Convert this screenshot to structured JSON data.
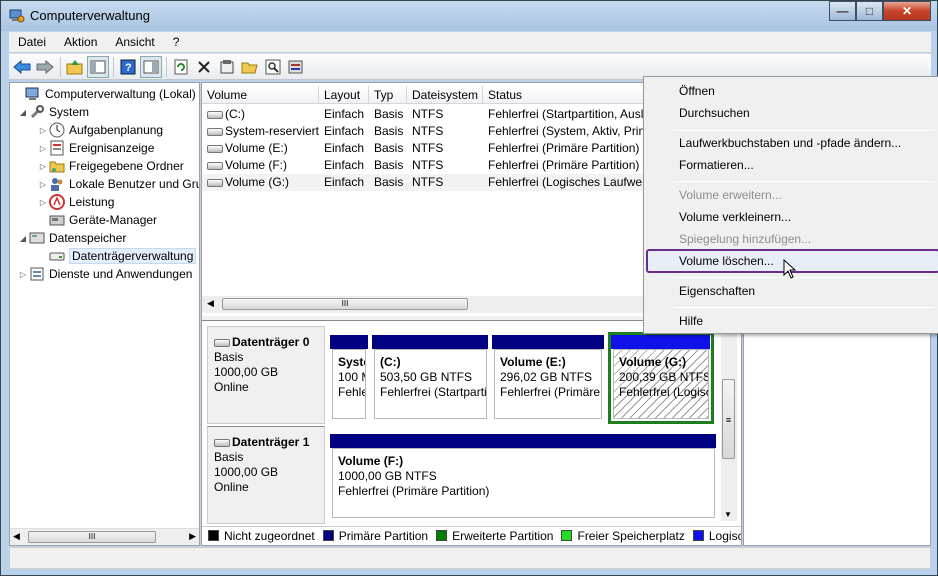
{
  "window": {
    "title": "Computerverwaltung"
  },
  "menu": [
    "Datei",
    "Aktion",
    "Ansicht",
    "?"
  ],
  "toolbar_icons": [
    "back-arrow-icon",
    "forward-arrow-icon",
    "up-folder-icon",
    "show-tree-icon",
    "help-icon",
    "show-pane-icon",
    "refresh-icon",
    "delete-icon",
    "properties-icon",
    "open-icon",
    "search-icon",
    "settings-icon"
  ],
  "tree": [
    {
      "label": "Computerverwaltung (Lokal)",
      "icon": "computer-icon"
    },
    {
      "label": "System",
      "icon": "tools-icon"
    },
    {
      "label": "Aufgabenplanung",
      "icon": "clock-icon"
    },
    {
      "label": "Ereignisanzeige",
      "icon": "event-icon"
    },
    {
      "label": "Freigegebene Ordner",
      "icon": "folder-icon"
    },
    {
      "label": "Lokale Benutzer und Gru",
      "icon": "users-icon"
    },
    {
      "label": "Leistung",
      "icon": "performance-icon"
    },
    {
      "label": "Geräte-Manager",
      "icon": "device-icon"
    },
    {
      "label": "Datenspeicher",
      "icon": "storage-icon"
    },
    {
      "label": "Datenträgerverwaltung",
      "icon": "disk-icon"
    },
    {
      "label": "Dienste und Anwendungen",
      "icon": "services-icon"
    }
  ],
  "columns": [
    "Volume",
    "Layout",
    "Typ",
    "Dateisystem",
    "Status"
  ],
  "rows": [
    [
      "(C:)",
      "Einfach",
      "Basis",
      "NTFS",
      "Fehlerfrei (Startpartition, Ausl"
    ],
    [
      "System-reserviert",
      "Einfach",
      "Basis",
      "NTFS",
      "Fehlerfrei (System, Aktiv, Prin"
    ],
    [
      "Volume (E:)",
      "Einfach",
      "Basis",
      "NTFS",
      "Fehlerfrei (Primäre Partition)"
    ],
    [
      "Volume (F:)",
      "Einfach",
      "Basis",
      "NTFS",
      "Fehlerfrei (Primäre Partition)"
    ],
    [
      "Volume (G:)",
      "Einfach",
      "Basis",
      "NTFS",
      "Fehlerfrei (Logisches Laufwer"
    ]
  ],
  "disks": [
    {
      "name": "Datenträger 0",
      "type": "Basis",
      "size": "1000,00 GB",
      "state": "Online",
      "partitions": [
        {
          "name": "Syste",
          "size": "100 M",
          "status": "Fehle"
        },
        {
          "name": "(C:)",
          "size": "503,50 GB NTFS",
          "status": "Fehlerfrei (Startparti"
        },
        {
          "name": "Volume  (E:)",
          "size": "296,02 GB NTFS",
          "status": "Fehlerfrei (Primäre"
        },
        {
          "name": "Volume  (G:)",
          "size": "200,39 GB NTFS",
          "status": "Fehlerfrei (Logisc"
        }
      ]
    },
    {
      "name": "Datenträger 1",
      "type": "Basis",
      "size": "1000,00 GB",
      "state": "Online",
      "partitions": [
        {
          "name": "Volume  (F:)",
          "size": "1000,00 GB NTFS",
          "status": "Fehlerfrei (Primäre Partition)"
        }
      ]
    }
  ],
  "legend": [
    {
      "label": "Nicht zugeordnet",
      "color": "#000000"
    },
    {
      "label": "Primäre Partition",
      "color": "#000080"
    },
    {
      "label": "Erweiterte Partition",
      "color": "#008000"
    },
    {
      "label": "Freier Speicherplatz",
      "color": "#22dd22"
    },
    {
      "label": "Logische",
      "color": "#1010e8"
    }
  ],
  "context_menu": [
    {
      "label": "Öffnen",
      "enabled": true
    },
    {
      "label": "Durchsuchen",
      "enabled": true
    },
    {
      "label": "Laufwerkbuchstaben und -pfade ändern...",
      "enabled": true
    },
    {
      "label": "Formatieren...",
      "enabled": true
    },
    {
      "label": "Volume erweitern...",
      "enabled": false
    },
    {
      "label": "Volume verkleinern...",
      "enabled": true
    },
    {
      "label": "Spiegelung hinzufügen...",
      "enabled": false
    },
    {
      "label": "Volume löschen...",
      "enabled": true,
      "highlighted": true
    },
    {
      "label": "Eigenschaften",
      "enabled": true
    },
    {
      "label": "Hilfe",
      "enabled": true
    }
  ],
  "scroll_thumb_glyph": "III",
  "vscroll_thumb_glyph": "≡"
}
